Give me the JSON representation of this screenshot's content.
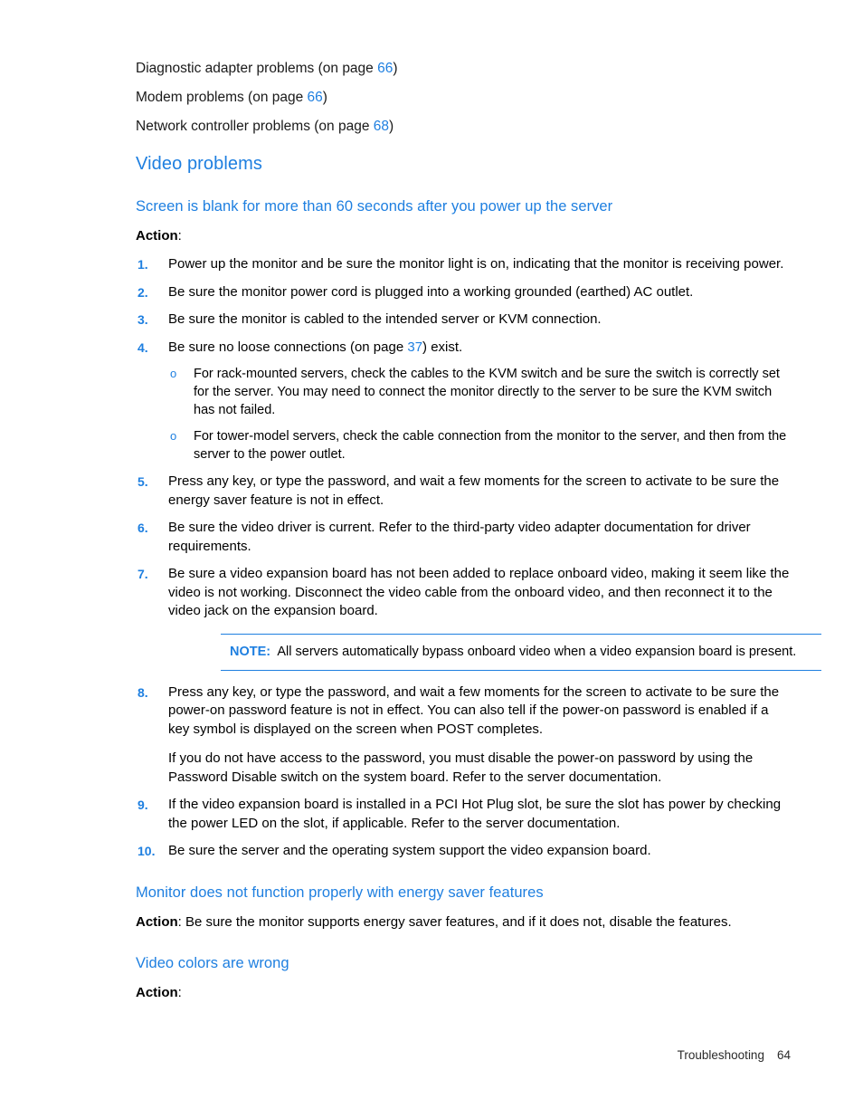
{
  "crossrefs": [
    {
      "text_before": "Diagnostic adapter problems (on page ",
      "page": "66",
      "text_after": ")"
    },
    {
      "text_before": "Modem problems (on page ",
      "page": "66",
      "text_after": ")"
    },
    {
      "text_before": "Network controller problems (on page ",
      "page": "68",
      "text_after": ")"
    }
  ],
  "section": {
    "heading": "Video problems"
  },
  "sub1": {
    "heading": "Screen is blank for more than 60 seconds after you power up the server",
    "action_label": "Action",
    "action_colon": ":"
  },
  "steps": [
    {
      "num": "1.",
      "text": "Power up the monitor and be sure the monitor light is on, indicating that the monitor is receiving power."
    },
    {
      "num": "2.",
      "text": "Be sure the monitor power cord is plugged into a working grounded (earthed) AC outlet."
    },
    {
      "num": "3.",
      "text": "Be sure the monitor is cabled to the intended server or KVM connection."
    },
    {
      "num": "4.",
      "text_before": "Be sure no loose connections (on page ",
      "page": "37",
      "text_after": ") exist.",
      "subbullets": [
        {
          "marker": "o",
          "text": "For rack-mounted servers, check the cables to the KVM switch and be sure the switch is correctly set for the server. You may need to connect the monitor directly to the server to be sure the KVM switch has not failed."
        },
        {
          "marker": "o",
          "text": "For tower-model servers, check the cable connection from the monitor to the server, and then from the server to the power outlet."
        }
      ]
    },
    {
      "num": "5.",
      "text": "Press any key, or type the password, and wait a few moments for the screen to activate to be sure the energy saver feature is not in effect."
    },
    {
      "num": "6.",
      "text": "Be sure the video driver is current. Refer to the third-party video adapter documentation for driver requirements."
    },
    {
      "num": "7.",
      "text": "Be sure a video expansion board has not been added to replace onboard video, making it seem like the video is not working. Disconnect the video cable from the onboard video, and then reconnect it to the video jack on the expansion board."
    },
    {
      "num": "8.",
      "text": "Press any key, or type the password, and wait a few moments for the screen to activate to be sure the power-on password feature is not in effect. You can also tell if the power-on password is enabled if a key symbol is displayed on the screen when POST completes.",
      "continuation": "If you do not have access to the password, you must disable the power-on password by using the Password Disable switch on the system board. Refer to the server documentation."
    },
    {
      "num": "9.",
      "text": "If the video expansion board is installed in a PCI Hot Plug slot, be sure the slot has power by checking the power LED on the slot, if applicable. Refer to the server documentation."
    },
    {
      "num": "10.",
      "text": "Be sure the server and the operating system support the video expansion board."
    }
  ],
  "note": {
    "label": "NOTE:",
    "text": "All servers automatically bypass onboard video when a video expansion board is present."
  },
  "sub2": {
    "heading": "Monitor does not function properly with energy saver features",
    "action_label": "Action",
    "action_text": ": Be sure the monitor supports energy saver features, and if it does not, disable the features."
  },
  "sub3": {
    "heading": "Video colors are wrong",
    "action_label": "Action",
    "action_colon": ":"
  },
  "footer": {
    "chapter": "Troubleshooting",
    "page_number": "64"
  },
  "colors": {
    "accent_blue": "#1e7fe0",
    "body_text": "#000000",
    "background": "#ffffff"
  }
}
